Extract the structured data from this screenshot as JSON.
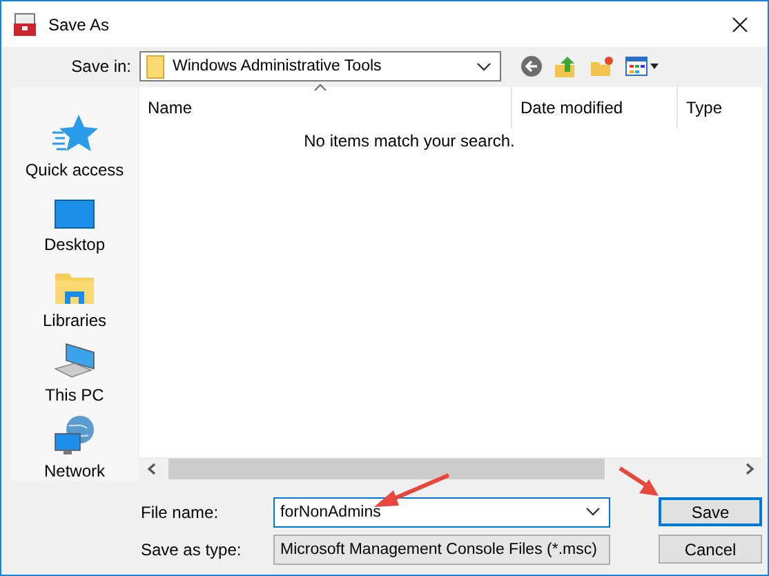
{
  "window": {
    "title": "Save As"
  },
  "save_in": {
    "label": "Save in:",
    "value": "Windows Administrative Tools"
  },
  "sidebar": {
    "items": [
      {
        "label": "Quick access",
        "kind": "star"
      },
      {
        "label": "Desktop",
        "kind": "desktop"
      },
      {
        "label": "Libraries",
        "kind": "libraries"
      },
      {
        "label": "This PC",
        "kind": "pc"
      },
      {
        "label": "Network",
        "kind": "network"
      }
    ]
  },
  "file_list": {
    "columns": [
      {
        "label": "Name",
        "sorted": true
      },
      {
        "label": "Date modified",
        "sorted": false
      },
      {
        "label": "Type",
        "sorted": false
      }
    ],
    "empty_message": "No items match your search."
  },
  "file_name": {
    "label": "File name:",
    "value": "forNonAdmins"
  },
  "save_as_type": {
    "label": "Save as type:",
    "value": "Microsoft Management Console Files (*.msc)"
  },
  "buttons": [
    {
      "label": "Save",
      "default": true
    },
    {
      "label": "Cancel",
      "default": false
    }
  ]
}
